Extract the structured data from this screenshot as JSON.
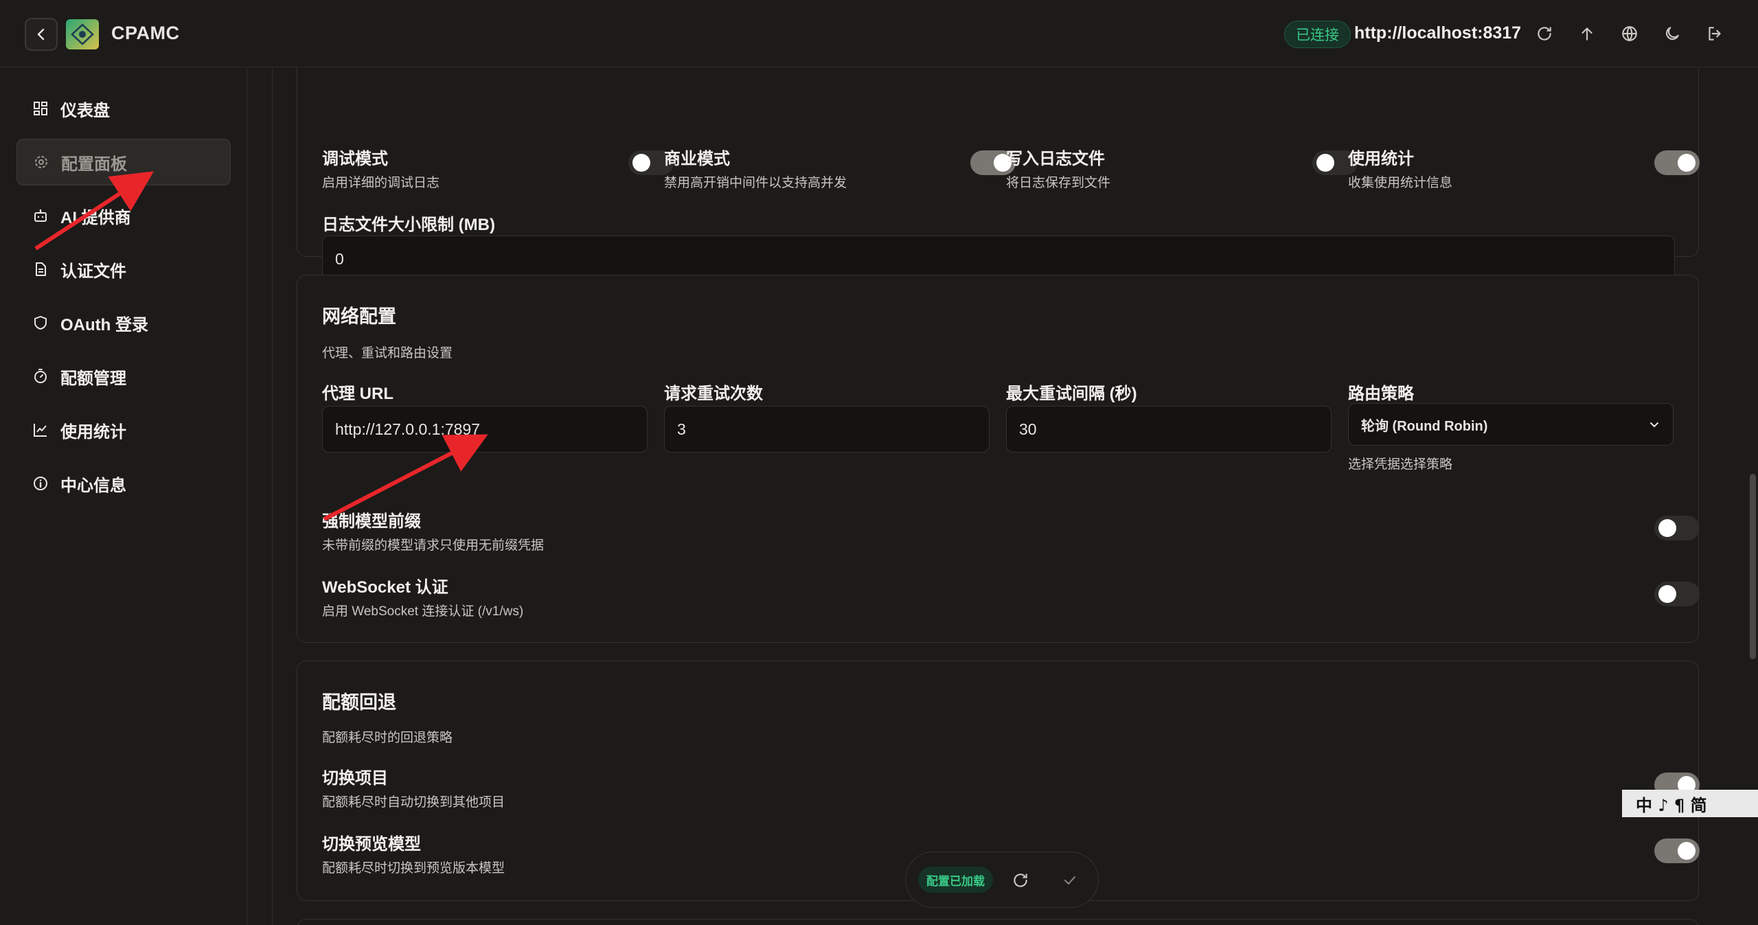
{
  "header": {
    "app_title": "CPAMC",
    "status": "已连接",
    "server_url": "http://localhost:8317",
    "icons": [
      "refresh-icon",
      "upload-icon",
      "globe-icon",
      "moon-icon",
      "logout-icon"
    ]
  },
  "sidebar": {
    "items": [
      {
        "label": "仪表盘",
        "icon": "dashboard-icon"
      },
      {
        "label": "配置面板",
        "icon": "gear-icon",
        "active": true
      },
      {
        "label": "AI 提供商",
        "icon": "bot-icon"
      },
      {
        "label": "认证文件",
        "icon": "file-icon"
      },
      {
        "label": "OAuth 登录",
        "icon": "shield-icon"
      },
      {
        "label": "配额管理",
        "icon": "timer-icon"
      },
      {
        "label": "使用统计",
        "icon": "chart-icon"
      },
      {
        "label": "中心信息",
        "icon": "info-icon"
      }
    ]
  },
  "general": {
    "debug": {
      "label": "调试模式",
      "desc": "启用详细的调试日志",
      "on": false
    },
    "commercial": {
      "label": "商业模式",
      "desc": "禁用高开销中间件以支持高并发",
      "on": true
    },
    "logfile": {
      "label": "写入日志文件",
      "desc": "将日志保存到文件",
      "on": false
    },
    "usage": {
      "label": "使用统计",
      "desc": "收集使用统计信息",
      "on": true
    },
    "log_size": {
      "label": "日志文件大小限制 (MB)",
      "value": "0"
    }
  },
  "network": {
    "title": "网络配置",
    "desc": "代理、重试和路由设置",
    "proxy": {
      "label": "代理 URL",
      "value": "http://127.0.0.1:7897"
    },
    "retry": {
      "label": "请求重试次数",
      "value": "3"
    },
    "interval": {
      "label": "最大重试间隔 (秒)",
      "value": "30"
    },
    "routing": {
      "label": "路由策略",
      "value": "轮询 (Round Robin)",
      "hint": "选择凭据选择策略"
    },
    "force_prefix": {
      "label": "强制模型前缀",
      "desc": "未带前缀的模型请求只使用无前缀凭据",
      "on": false
    },
    "ws_auth": {
      "label": "WebSocket 认证",
      "desc": "启用 WebSocket 连接认证 (/v1/ws)",
      "on": false
    }
  },
  "quota": {
    "title": "配额回退",
    "desc": "配额耗尽时的回退策略",
    "switch_project": {
      "label": "切换项目",
      "desc": "配额耗尽时自动切换到其他项目",
      "on": true
    },
    "switch_preview": {
      "label": "切换预览模型",
      "desc": "配额耗尽时切换到预览版本模型",
      "on": true
    }
  },
  "float_bar": {
    "badge": "配置已加载"
  },
  "ime": {
    "text": "中 ♪ ¶ 简"
  },
  "colors": {
    "accent_green": "#38c885",
    "arrow_red": "#e8262a"
  }
}
